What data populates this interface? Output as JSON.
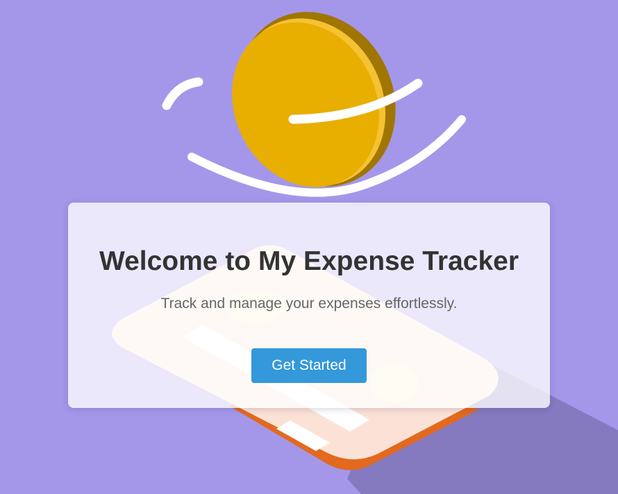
{
  "hero": {
    "title": "Welcome to My Expense Tracker",
    "subtitle": "Track and manage your expenses effortlessly.",
    "cta_label": "Get Started"
  },
  "illustration": {
    "icons": [
      "gold-coin-icon",
      "credit-card-icon",
      "motion-lines-icon"
    ]
  },
  "colors": {
    "background": "#a497ea",
    "coin_gold": "#e8ae00",
    "card_orange": "#e3691f",
    "card_face": "#fce2d6",
    "button": "#3498db",
    "title_text": "#333333",
    "subtitle_text": "#666666"
  }
}
